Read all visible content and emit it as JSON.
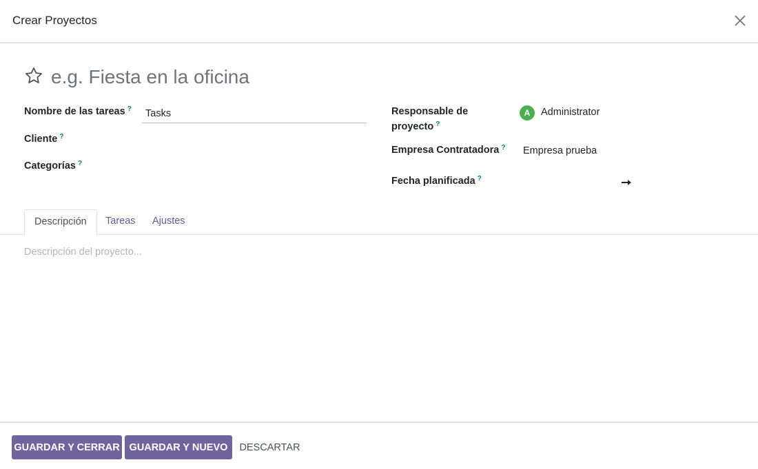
{
  "dialog": {
    "title": "Crear Proyectos"
  },
  "project": {
    "name_value": "",
    "name_placeholder": "e.g. Fiesta en la oficina",
    "favorite_icon": "star-outline-icon"
  },
  "left_fields": {
    "task_name_label": "Nombre de las tareas",
    "task_name_value": "Tasks",
    "customer_label": "Cliente",
    "customer_value": "",
    "categories_label": "Categorías",
    "categories_value": ""
  },
  "right_fields": {
    "manager_label_line1": "Responsable de",
    "manager_label_line2": "proyecto",
    "manager_avatar_letter": "A",
    "manager_value": "Administrator",
    "company_label": "Empresa Contratadora",
    "company_value": "Empresa prueba",
    "date_label": "Fecha planificada",
    "date_start": "",
    "date_end": ""
  },
  "help_mark": "?",
  "tabs": [
    {
      "label": "Descripción",
      "active": true
    },
    {
      "label": "Tareas",
      "active": false
    },
    {
      "label": "Ajustes",
      "active": false
    }
  ],
  "description": {
    "value": "",
    "placeholder": "Descripción del proyecto..."
  },
  "footer": {
    "save_close_label": "GUARDAR Y CERRAR",
    "save_new_label": "GUARDAR Y NUEVO",
    "discard_label": "DESCARTAR"
  },
  "colors": {
    "primary": "#71639e",
    "help": "#017e84",
    "avatar": "#4caf50",
    "tab_link": "#6a5596"
  }
}
